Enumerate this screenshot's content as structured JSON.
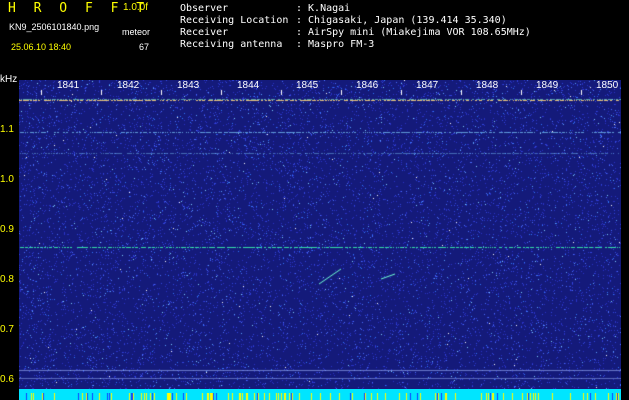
{
  "header": {
    "app_title": "H R O F F T",
    "version": "1.0.0f",
    "filename": "KN9_2506101840.png",
    "mode_label": "meteor",
    "datetime": "25.06.10 18:40",
    "mode_value": "67"
  },
  "info": [
    {
      "label": "Observer",
      "value": ": K.Nagai"
    },
    {
      "label": "Receiving Location",
      "value": ": Chigasaki, Japan (139.414 35.340)"
    },
    {
      "label": "Receiver",
      "value": ": AirSpy mini (Miakejima VOR 108.65MHz)"
    },
    {
      "label": "Receiving antenna",
      "value": ": Maspro FM-3"
    }
  ],
  "axis": {
    "y_unit": "kHz",
    "y_ticks": [
      "1.1",
      "1.0",
      "0.9",
      "0.8",
      "0.7",
      "0.6"
    ],
    "x_ticks": [
      "1841",
      "1842",
      "1843",
      "1844",
      "1845",
      "1846",
      "1847",
      "1848",
      "1849",
      "1850"
    ]
  },
  "colors": {
    "background": "#000000",
    "spectrogram_base": "#141a7a",
    "header_text": "#ffff00",
    "info_text": "#ffffff",
    "signal": "#00ffa0",
    "bottom_bar": "#00e5ff"
  }
}
